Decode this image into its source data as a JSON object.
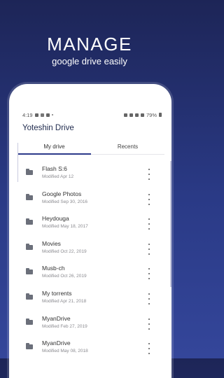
{
  "promo": {
    "title": "MANAGE",
    "subtitle": "google drive easily"
  },
  "status_bar": {
    "time": "4:19",
    "battery": "79%"
  },
  "app": {
    "title": "Yoteshin Drive"
  },
  "tabs": [
    {
      "label": "My drive",
      "active": true
    },
    {
      "label": "Recents",
      "active": false
    }
  ],
  "files": [
    {
      "name": "Flash S:6",
      "modified": "Modified Apr 12"
    },
    {
      "name": "Google Photos",
      "modified": "Modified Sep 30, 2016"
    },
    {
      "name": "Heydouga",
      "modified": "Modified May 18, 2017"
    },
    {
      "name": "Movies",
      "modified": "Modified Oct 22, 2019"
    },
    {
      "name": "Musb-ch",
      "modified": "Modified Oct 26, 2019"
    },
    {
      "name": "My torrents",
      "modified": "Modified Apr 21, 2018"
    },
    {
      "name": "MyanDrive",
      "modified": "Modified Feb 27, 2019"
    },
    {
      "name": "MyanDrive",
      "modified": "Modified May 08, 2018"
    }
  ],
  "colors": {
    "background_top": "#1d2557",
    "background_bottom": "#34469a",
    "accent": "#2c3a8a"
  },
  "icons": [
    "folder-icon",
    "more-vert-icon"
  ]
}
